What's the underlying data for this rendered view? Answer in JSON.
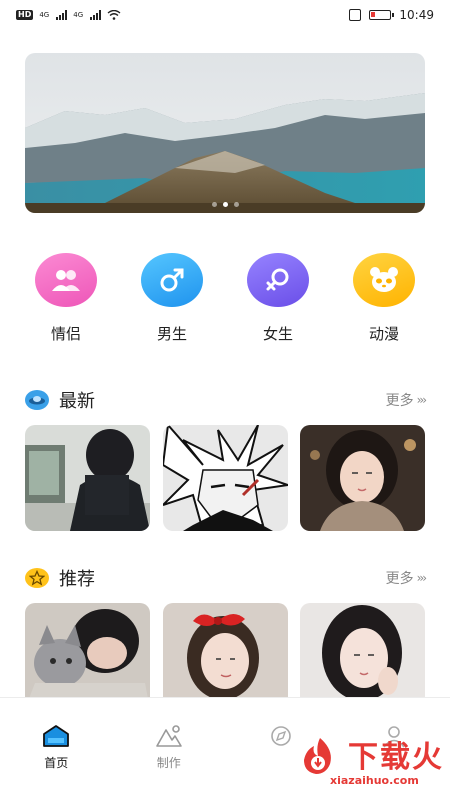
{
  "status_bar": {
    "time": "10:49",
    "hd": "HD",
    "net1": "4G",
    "net2": "4G"
  },
  "banner": {
    "slides": 3,
    "active_slide": 2
  },
  "categories": [
    {
      "label": "情侣",
      "icon": "couple-icon",
      "color": "#f36bc6"
    },
    {
      "label": "男生",
      "icon": "male-icon",
      "color": "#2ea6f5"
    },
    {
      "label": "女生",
      "icon": "female-icon",
      "color": "#7b63f2"
    },
    {
      "label": "动漫",
      "icon": "panda-icon",
      "color": "#ffc11f"
    }
  ],
  "sections": {
    "latest": {
      "title": "最新",
      "more": "更多",
      "icon": "ufo-icon"
    },
    "recommend": {
      "title": "推荐",
      "more": "更多",
      "icon": "star-icon"
    }
  },
  "tabs": [
    {
      "label": "首页",
      "icon": "home-icon",
      "active": true
    },
    {
      "label": "制作",
      "icon": "create-icon",
      "active": false
    },
    {
      "label": "",
      "icon": "explore-icon",
      "active": false
    },
    {
      "label": "",
      "icon": "profile-icon",
      "active": false
    }
  ],
  "watermark": {
    "title": "下载火",
    "domain": "xiazaihuo.com"
  }
}
